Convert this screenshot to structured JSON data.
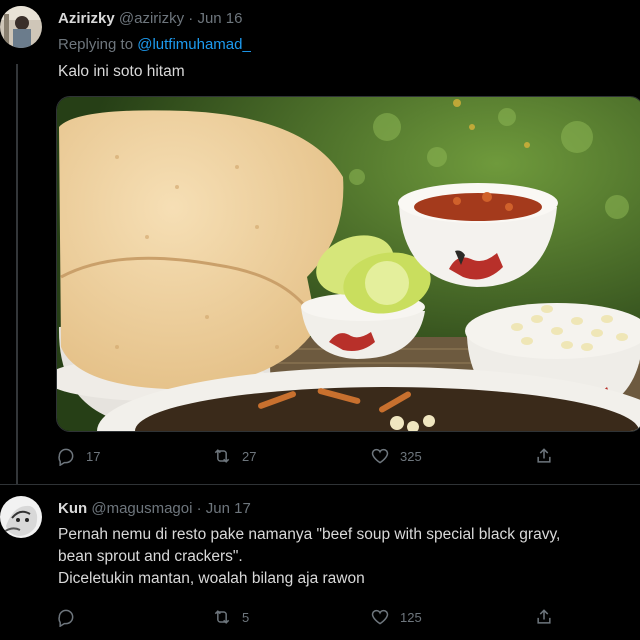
{
  "tweets": [
    {
      "author_name": "Azirizky",
      "handle": "@azirizky",
      "date": "· Jun 16",
      "replying_prefix": "Replying to",
      "replying_to": "@lutfimuhamad_",
      "text": "Kalo ini soto hitam",
      "actions": {
        "reply_count": "17",
        "retweet_count": "27",
        "like_count": "325"
      }
    },
    {
      "author_name": "Kun",
      "handle": "@magusmagoi",
      "date": "· Jun 17",
      "text_lines": [
        "Pernah nemu di resto pake namanya \"beef soup with special black gravy,",
        "bean sprout and crackers\".",
        "Diceletukin mantan, woalah bilang aja rawon"
      ],
      "actions": {
        "reply_count": "",
        "retweet_count": "5",
        "like_count": "125"
      }
    }
  ],
  "icons": {
    "reply": "reply-icon",
    "retweet": "retweet-icon",
    "like": "heart-icon",
    "share": "share-icon"
  },
  "colors": {
    "background": "#000000",
    "text": "#d9d9d9",
    "muted": "#6e767d",
    "link": "#1d9bf0",
    "divider": "#2f3336"
  }
}
